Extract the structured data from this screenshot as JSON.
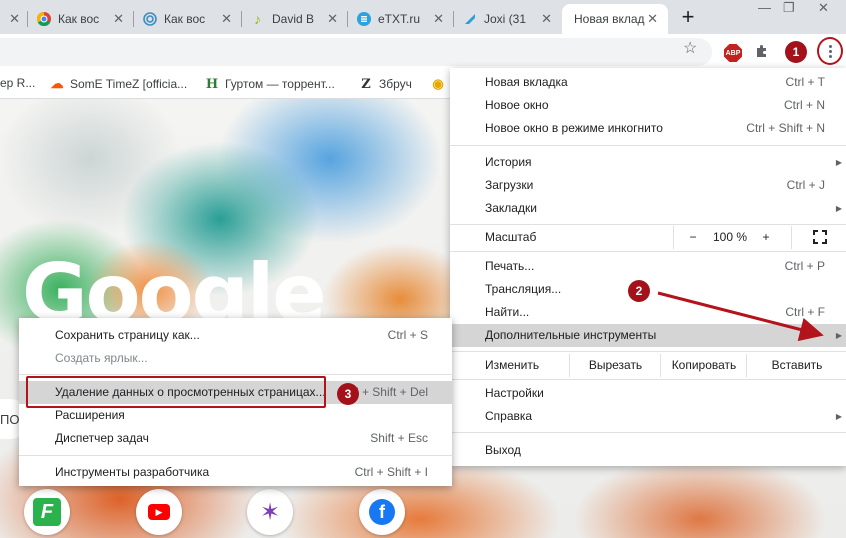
{
  "tabs": [
    {
      "title": "Как вос",
      "icon": "chrome-icon"
    },
    {
      "title": "Как вос",
      "icon": "spiral-icon"
    },
    {
      "title": "David B",
      "icon": "music-note-icon"
    },
    {
      "title": "eTXT.ru",
      "icon": "etxt-icon"
    },
    {
      "title": "Joxi (31",
      "icon": "joxi-icon"
    },
    {
      "title": "Новая вклад",
      "icon": "none",
      "active": true
    }
  ],
  "new_tab_label": "+",
  "bookmarks": [
    {
      "label": "ep R..."
    },
    {
      "label": "SomE TimeZ [officia..."
    },
    {
      "label": "Гуртом — торрент..."
    },
    {
      "label": "Збруч"
    }
  ],
  "extensions": {
    "abp_label": "ABP"
  },
  "menu": {
    "new_tab": {
      "label": "Новая вкладка",
      "shortcut": "Ctrl + T"
    },
    "new_window": {
      "label": "Новое окно",
      "shortcut": "Ctrl + N"
    },
    "incognito": {
      "label": "Новое окно в режиме инкогнито",
      "shortcut": "Ctrl + Shift + N"
    },
    "history": {
      "label": "История"
    },
    "downloads": {
      "label": "Загрузки",
      "shortcut": "Ctrl + J"
    },
    "bookmarks": {
      "label": "Закладки"
    },
    "zoom": {
      "label": "Масштаб",
      "minus": "−",
      "value": "100 %",
      "plus": "+"
    },
    "print": {
      "label": "Печать...",
      "shortcut": "Ctrl + P"
    },
    "cast": {
      "label": "Трансляция..."
    },
    "find": {
      "label": "Найти...",
      "shortcut": "Ctrl + F"
    },
    "more_tools": {
      "label": "Дополнительные инструменты"
    },
    "edit": {
      "label": "Изменить",
      "cut": "Вырезать",
      "copy": "Копировать",
      "paste": "Вставить"
    },
    "settings": {
      "label": "Настройки"
    },
    "help": {
      "label": "Справка"
    },
    "exit": {
      "label": "Выход"
    }
  },
  "submenu": {
    "save_page": {
      "label": "Сохранить страницу как...",
      "shortcut": "Ctrl + S"
    },
    "create_shortcut": {
      "label": "Создать ярлык..."
    },
    "clear_data": {
      "label": "Удаление данных о просмотренных страницах...",
      "shortcut": "Ctrl + Shift + Del"
    },
    "extensions": {
      "label": "Расширения"
    },
    "task_manager": {
      "label": "Диспетчер задач",
      "shortcut": "Shift + Esc"
    },
    "devtools": {
      "label": "Инструменты разработчика",
      "shortcut": "Ctrl + Shift + I"
    }
  },
  "page": {
    "logo_text": "Google",
    "search_stub": "ПОИ"
  },
  "annotations": {
    "step1": "1",
    "step2": "2",
    "step3": "3"
  },
  "colors": {
    "annotation_red": "#b3131a",
    "menu_highlight": "#d5d5d5",
    "tabstrip": "#dee1e6"
  }
}
